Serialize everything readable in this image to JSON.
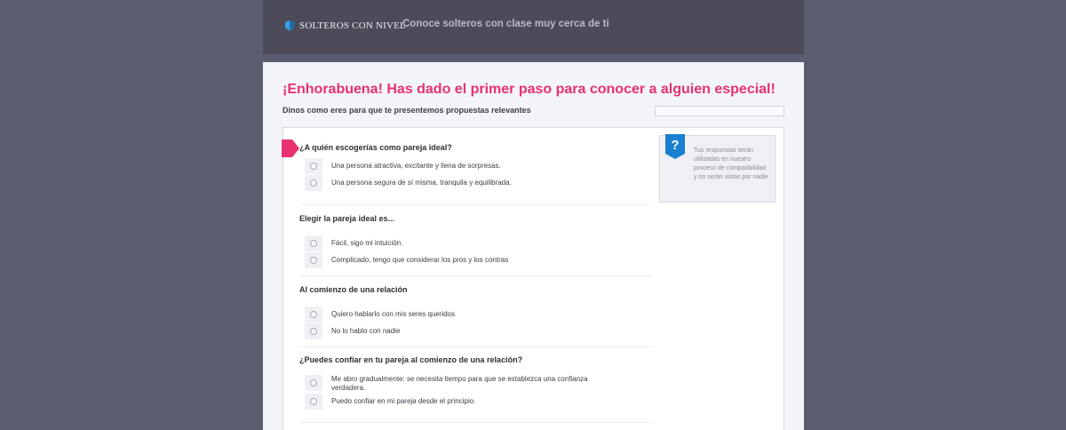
{
  "header": {
    "brand": "SOLTEROS CON NIVEL",
    "tagline": "Conoce solteros con clase muy cerca de ti"
  },
  "intro": {
    "title": "¡Enhorabuena! Has dado el primer paso para conocer a alguien especial!",
    "subtitle": "Dinos como eres para que te presentemos propuestas relevantes",
    "progress_fraction": 0.0
  },
  "help": {
    "badge": "?",
    "text": "Tus respuestas serán utilizadas en nuestro proceso de compatibilidad y no serán vistas por nadie"
  },
  "questions": [
    {
      "title": "¿A quién escogerías como pareja ideal?",
      "options": [
        "Una persona atractiva, excitante y llena de sorpresas.",
        "Una persona segura de sí misma, tranquila y equilibrada."
      ]
    },
    {
      "title": "Elegir la pareja ideal es...",
      "options": [
        "Fácil, sigo mi intuición.",
        "Complicado, tengo que considerar los pros y los contras"
      ]
    },
    {
      "title": "Al comienzo de una relación",
      "options": [
        "Quiero hablarlo con mis seres queridos",
        "No lo hablo con nadie"
      ]
    },
    {
      "title": "¿Puedes confiar en tu pareja al comienzo de una relación?",
      "options": [
        "Me abro gradualmente: se necesita tiempo para que se establezca una confianza verdadera.",
        "Puedo confiar en mi pareja desde el principio."
      ]
    }
  ],
  "colors": {
    "accent": "#e8316e",
    "help_badge": "#1a7fd0",
    "page_bg": "#595d6f",
    "header_bg": "#4b4b59"
  }
}
